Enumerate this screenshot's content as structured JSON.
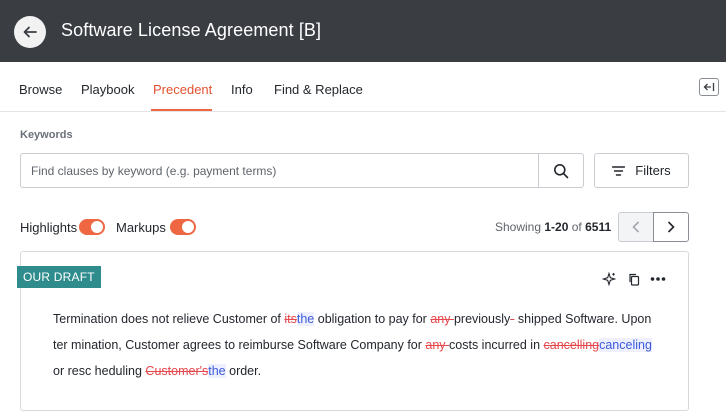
{
  "header": {
    "title": "Software License Agreement [B]",
    "back_icon": "arrow-left-icon"
  },
  "tabs": [
    {
      "label": "Browse",
      "active": false
    },
    {
      "label": "Playbook",
      "active": false
    },
    {
      "label": "Precedent",
      "active": true
    },
    {
      "label": "Info",
      "active": false
    },
    {
      "label": "Find & Replace",
      "active": false
    }
  ],
  "keywords": {
    "label": "Keywords",
    "search_placeholder": "Find clauses by keyword (e.g. payment terms)",
    "search_value": "",
    "filters_label": "Filters"
  },
  "toggles": {
    "highlights_label": "Highlights",
    "highlights_on": true,
    "markups_label": "Markups",
    "markups_on": true
  },
  "pagination": {
    "prefix": "Showing ",
    "range": "1-20",
    "of": " of ",
    "total": "6511"
  },
  "card": {
    "badge": "OUR DRAFT",
    "clause": [
      {
        "t": "Termination does not relieve Customer of ",
        "k": "text"
      },
      {
        "t": "its",
        "k": "del"
      },
      {
        "t": "the",
        "k": "ins"
      },
      {
        "t": " obligation to pay for ",
        "k": "text"
      },
      {
        "t": "any ",
        "k": "del"
      },
      {
        "t": "previously",
        "k": "text"
      },
      {
        "t": "-",
        "k": "del"
      },
      {
        "t": " shipped Software. Upon ter mination, Customer agrees to reimburse Software Company for ",
        "k": "text"
      },
      {
        "t": "any ",
        "k": "del"
      },
      {
        "t": "costs incurred in ",
        "k": "text"
      },
      {
        "t": "cancelling",
        "k": "del"
      },
      {
        "t": "canceling",
        "k": "ins"
      },
      {
        "t": " or resc heduling ",
        "k": "text"
      },
      {
        "t": "Customer's",
        "k": "del"
      },
      {
        "t": "the",
        "k": "ins"
      },
      {
        "t": " order.",
        "k": "text"
      }
    ]
  },
  "colors": {
    "accent": "#ef6642",
    "header_bg": "#3a3d42",
    "badge_bg": "#2f8c8c",
    "deletion": "#e5484d",
    "insertion": "#3b5bdb"
  }
}
